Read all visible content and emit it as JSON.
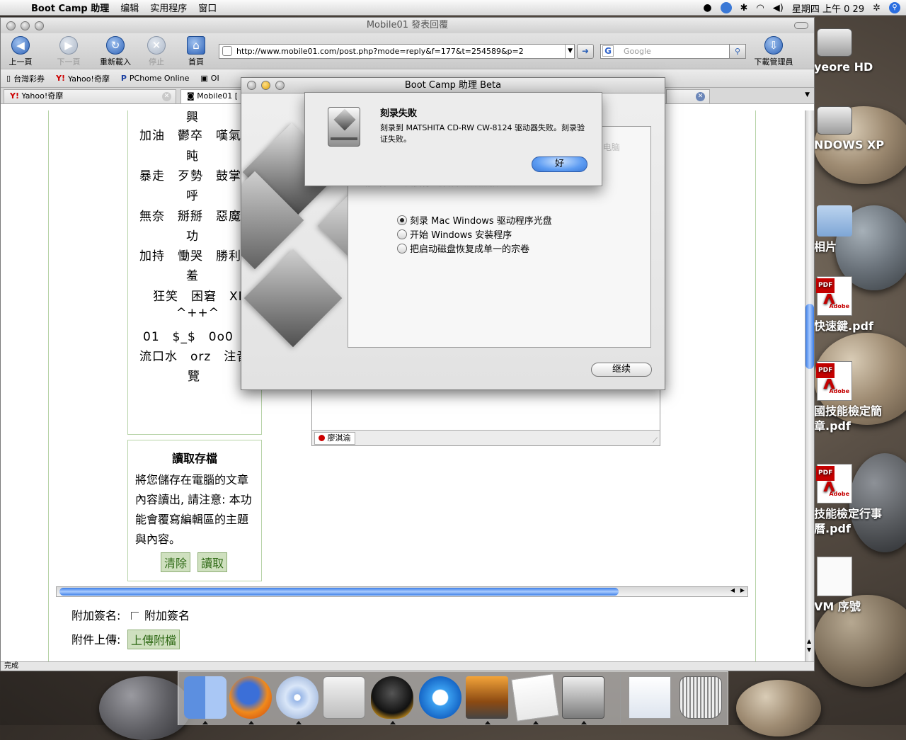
{
  "menubar": {
    "app": "Boot Camp 助理",
    "items": [
      "编辑",
      "实用程序",
      "窗口"
    ],
    "clock": "星期四 上午 0 29"
  },
  "desktop": {
    "icons": [
      {
        "label": "yeore HD",
        "kind": "disk"
      },
      {
        "label": "NDOWS XP",
        "kind": "disk"
      },
      {
        "label": "相片",
        "kind": "folder"
      },
      {
        "label": "快速鍵.pdf",
        "kind": "pdf"
      },
      {
        "label": "國技能檢定簡章.pdf",
        "kind": "pdf"
      },
      {
        "label": "技能檢定行事曆.pdf",
        "kind": "pdf"
      },
      {
        "label": "VM 序號",
        "kind": "document"
      }
    ],
    "pdf_tag": "PDF",
    "adobe_text": "Adobe"
  },
  "browser": {
    "title": "Mobile01 發表回覆",
    "toolbar": {
      "back": "上一頁",
      "forward": "下一頁",
      "reload": "重新載入",
      "stop": "停止",
      "home": "首頁",
      "downloads": "下載管理員"
    },
    "url": "http://www.mobile01.com/post.php?mode=reply&f=177&t=254589&p=2",
    "search_placeholder": "Google",
    "search_engine_letter": "G",
    "bookmarks": [
      "台灣彩券",
      "Yahoo!奇摩",
      "PChome Online",
      "OI"
    ],
    "tabs": [
      "Yahoo!奇摩",
      "Mobile01 [",
      ""
    ],
    "status": "完成"
  },
  "page": {
    "emoticon_rows": [
      "興",
      "加油　鬱卒　嘆氣　打",
      "盹",
      "暴走　歹勢　鼓掌　翻",
      "呼",
      "無奈　掰掰　惡魔　成",
      "功",
      "加持　慟哭　勝利　害",
      "羞",
      "狂笑　困窘　XD",
      "^++^",
      "01　$_$　0o0　囧",
      "流口水　orz　注音　預",
      "覽"
    ],
    "load_title": "讀取存檔",
    "load_desc": "將您儲存在電腦的文章內容讀出, 請注意: 本功能會覆寫編輯區的主題與內容。",
    "clear_btn": "清除",
    "read_btn": "讀取",
    "signature_label": "附加簽名:",
    "signature_check": "附加簽名",
    "upload_label": "附件上傳:",
    "upload_btn": "上傳附檔"
  },
  "chat": {
    "user": "廖淇渝"
  },
  "bootcamp": {
    "title": "Boot Camp 助理 Beta",
    "intro_line1": "此助理可帮助您在 Mac 电脑上安装 Microsoft Windows。您的电脑",
    "intro_line2": "的启动磁盘已经被分区以便 Windows",
    "intro_line3": "请选择您想要执行的操作，然后点按继续。",
    "options": [
      {
        "label": "刻录 Mac Windows 驱动程序光盘",
        "selected": true
      },
      {
        "label": "开始 Windows 安装程序",
        "selected": false
      },
      {
        "label": "把启动磁盘恢复成单一的宗卷",
        "selected": false
      }
    ],
    "continue_btn": "继续"
  },
  "alert": {
    "title": "刻录失败",
    "message": "刻录到 MATSHITA CD-RW CW-8124 驱动器失败。刻录验证失败。",
    "ok_btn": "好"
  },
  "dock": {
    "items": [
      "finder-icon",
      "firefox-icon",
      "itunes-icon",
      "bootcamp-apple-icon",
      "qq-penguin-icon",
      "quicktime-icon",
      "iphoto-icon",
      "textedit-icon",
      "bootcamp-assistant-icon",
      "activity-monitor-icon",
      "trash-icon"
    ]
  },
  "colors": {
    "accent": "#3a7ce6",
    "green_button": "#cfe0bf",
    "alert_ok": "#5d9cf2"
  }
}
